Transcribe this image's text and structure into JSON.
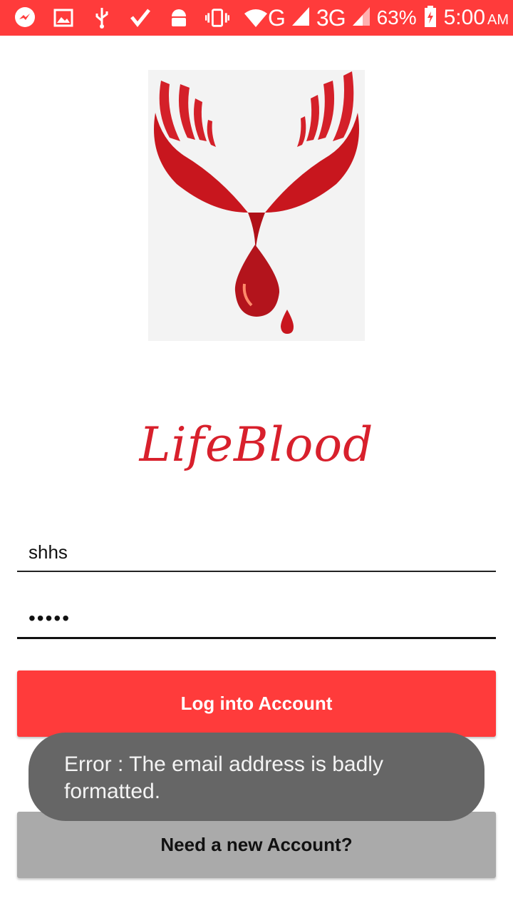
{
  "status_bar": {
    "icons": [
      "messenger-icon",
      "gallery-icon",
      "usb-icon",
      "check-icon",
      "android-icon",
      "vibrate-icon",
      "wifi-icon"
    ],
    "network_g": "G",
    "network_3g": "3G",
    "battery": "63%",
    "time": "5:00",
    "ampm": "AM"
  },
  "app": {
    "brand": "LifeBlood"
  },
  "form": {
    "email_value": "shhs",
    "password_value": "•••••",
    "login_label": "Log into Account",
    "signup_label": "Need a new Account?"
  },
  "toast": {
    "message": "Error : The email address is badly formatted."
  },
  "colors": {
    "accent": "#ff3b3b",
    "logo_red": "#d8202c",
    "toast_bg": "#666666",
    "secondary_button": "#aaaaaa"
  }
}
